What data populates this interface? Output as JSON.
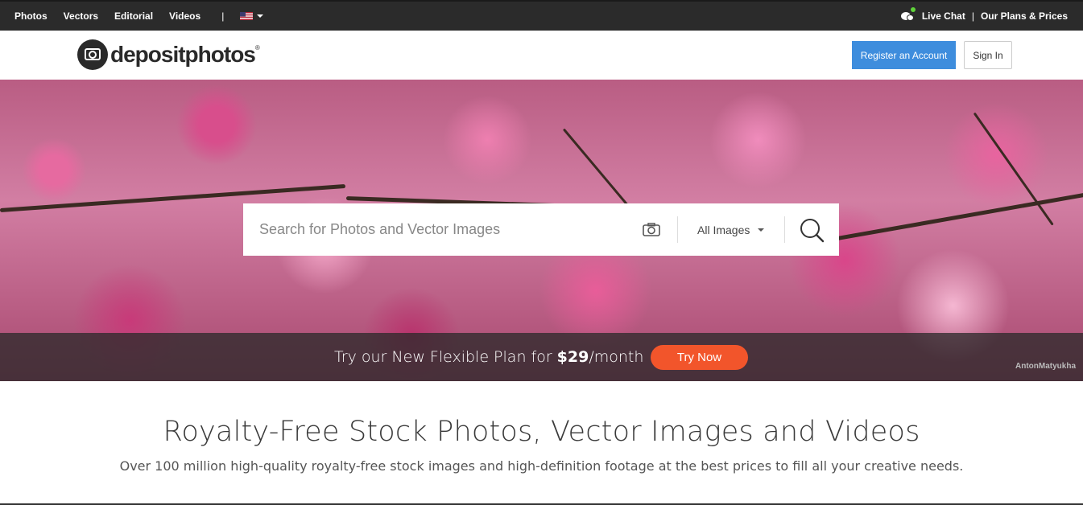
{
  "topnav": {
    "links": [
      "Photos",
      "Vectors",
      "Editorial",
      "Videos"
    ],
    "separator": "|",
    "language_flag": "us-flag-icon",
    "live_chat": "Live Chat",
    "divider": "|",
    "plans": "Our Plans & Prices"
  },
  "header": {
    "logo_text": "depositphotos",
    "logo_reg": "®",
    "register_label": "Register an Account",
    "signin_label": "Sign In"
  },
  "search": {
    "placeholder": "Search for Photos and Vector Images",
    "type_selected": "All Images"
  },
  "promo": {
    "text": "Try our New Flexible Plan for",
    "price": "$29",
    "period": "/month",
    "cta": "Try Now",
    "photo_credit": "AntonMatyukha"
  },
  "main": {
    "title": "Royalty-Free Stock Photos, Vector Images and Videos",
    "subtitle": "Over 100 million high-quality royalty-free stock images and high-definition footage at the best prices to fill all your creative needs."
  },
  "colors": {
    "topbar": "#2b2b2b",
    "register": "#3e8ddd",
    "try_now": "#f2552b",
    "chat_dot": "#5fd33a"
  }
}
